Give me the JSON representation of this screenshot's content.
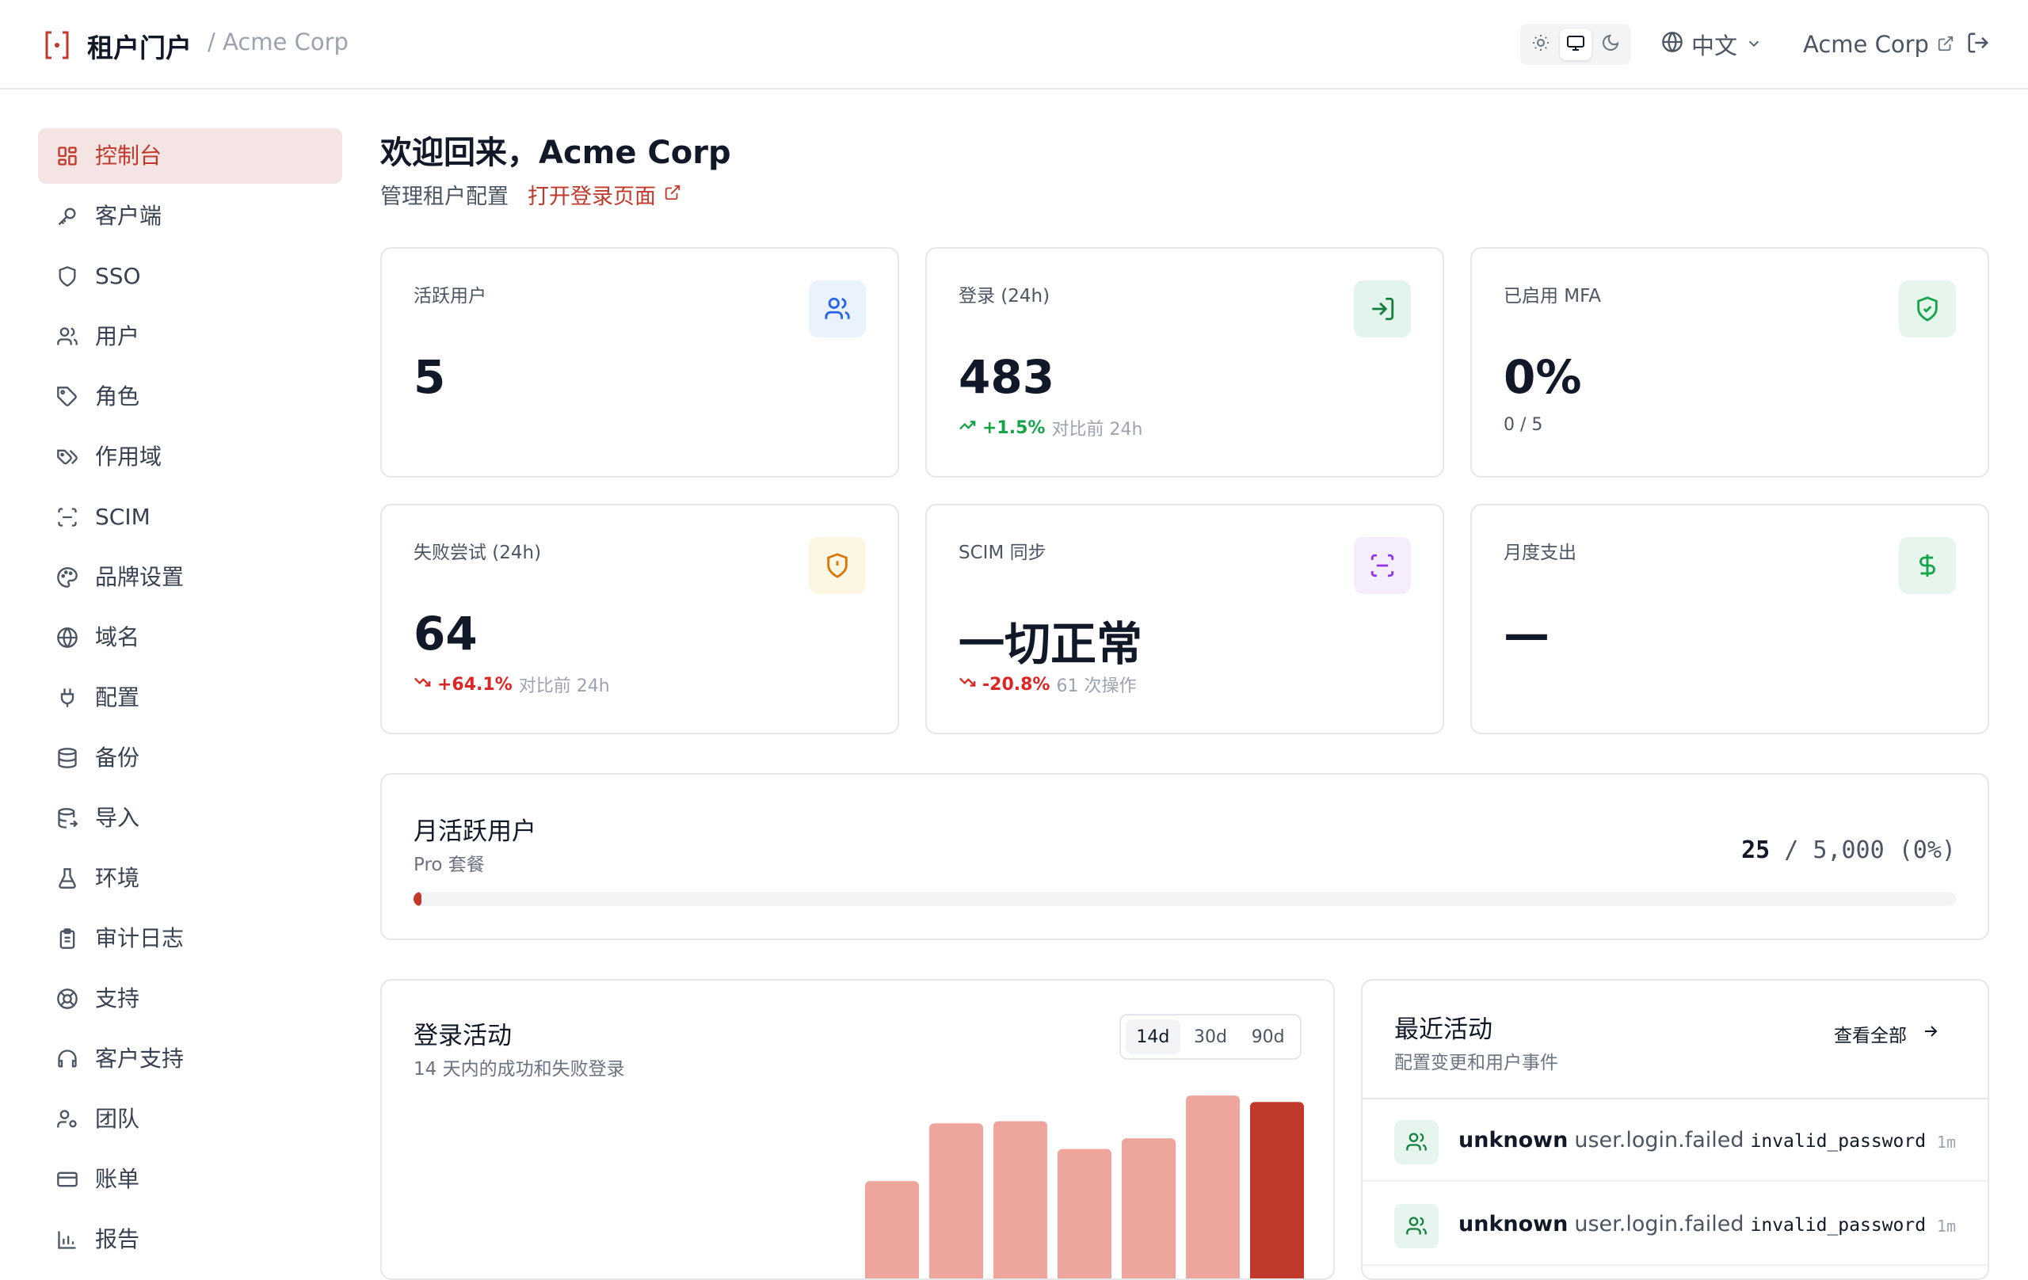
{
  "header": {
    "brand_title": "租户门户",
    "tenant_breadcrumb": "/ Acme Corp",
    "theme_options": [
      "light",
      "system",
      "dark"
    ],
    "theme_selected": "system",
    "language": "中文",
    "tenant_link": "Acme Corp"
  },
  "sidebar": {
    "items": [
      {
        "label": "控制台",
        "icon": "dashboard-icon",
        "active": true
      },
      {
        "label": "客户端",
        "icon": "key-icon"
      },
      {
        "label": "SSO",
        "icon": "shield-icon"
      },
      {
        "label": "用户",
        "icon": "users-icon"
      },
      {
        "label": "角色",
        "icon": "tag-icon"
      },
      {
        "label": "作用域",
        "icon": "tags-icon"
      },
      {
        "label": "SCIM",
        "icon": "scan-icon"
      },
      {
        "label": "品牌设置",
        "icon": "palette-icon"
      },
      {
        "label": "域名",
        "icon": "globe-icon"
      },
      {
        "label": "配置",
        "icon": "plug-icon"
      },
      {
        "label": "备份",
        "icon": "database-icon"
      },
      {
        "label": "导入",
        "icon": "database-import-icon"
      },
      {
        "label": "环境",
        "icon": "flask-icon"
      },
      {
        "label": "审计日志",
        "icon": "clipboard-icon"
      },
      {
        "label": "支持",
        "icon": "lifebuoy-icon"
      },
      {
        "label": "客户支持",
        "icon": "headset-icon"
      },
      {
        "label": "团队",
        "icon": "user-cog-icon"
      },
      {
        "label": "账单",
        "icon": "credit-card-icon"
      },
      {
        "label": "报告",
        "icon": "bar-chart-icon"
      }
    ]
  },
  "main": {
    "welcome": "欢迎回来，Acme Corp",
    "subtitle": "管理租户配置",
    "login_page_link": "打开登录页面"
  },
  "stats": [
    {
      "label": "活跃用户",
      "value": "5",
      "icon": "users-icon",
      "color": "#2563eb",
      "bg": "#eaf2fd"
    },
    {
      "label": "登录 (24h)",
      "value": "483",
      "trend": "+1.5%",
      "trend_dir": "up",
      "note": "对比前 24h",
      "icon": "login-icon",
      "color": "#15803d",
      "bg": "#e3f4ec"
    },
    {
      "label": "已启用 MFA",
      "value": "0%",
      "sub": "0 / 5",
      "icon": "shield-check-icon",
      "color": "#16a34a",
      "bg": "#e6f6ed"
    },
    {
      "label": "失败尝试 (24h)",
      "value": "64",
      "trend": "+64.1%",
      "trend_dir": "down",
      "note": "对比前 24h",
      "icon": "shield-alert-icon",
      "color": "#d97706",
      "bg": "#fdf6e3"
    },
    {
      "label": "SCIM 同步",
      "value": "一切正常",
      "trend": "-20.8%",
      "trend_dir": "down",
      "note": "61 次操作",
      "icon": "scan-icon",
      "color": "#9333ea",
      "bg": "#f5ecfc"
    },
    {
      "label": "月度支出",
      "value": "—",
      "icon": "dollar-icon",
      "color": "#16a34a",
      "bg": "#e6f6ed"
    }
  ],
  "mau": {
    "title": "月活跃用户",
    "plan": "Pro 套餐",
    "used": "25",
    "limit_text": "/ 5,000 (0%)",
    "fraction": 0.005
  },
  "activity": {
    "title": "登录活动",
    "subtitle": "14 天内的成功和失败登录",
    "ranges": [
      "14d",
      "30d",
      "90d"
    ],
    "selected_range": "14d"
  },
  "chart_data": {
    "type": "bar",
    "title": "登录活动",
    "subtitle": "14 天内的成功和失败登录",
    "visible_values_relative": [
      0.47,
      0.74,
      0.75,
      0.62,
      0.67,
      0.87,
      0.84
    ],
    "colors": {
      "bar": "#eea59b",
      "last": "#c0392b"
    }
  },
  "recent": {
    "title": "最近活动",
    "subtitle": "配置变更和用户事件",
    "view_all": "查看全部",
    "events": [
      {
        "actor": "unknown",
        "action": "user.login.failed",
        "reason": "invalid_password",
        "time": "1m"
      },
      {
        "actor": "unknown",
        "action": "user.login.failed",
        "reason": "invalid_password",
        "time": "1m"
      }
    ]
  }
}
